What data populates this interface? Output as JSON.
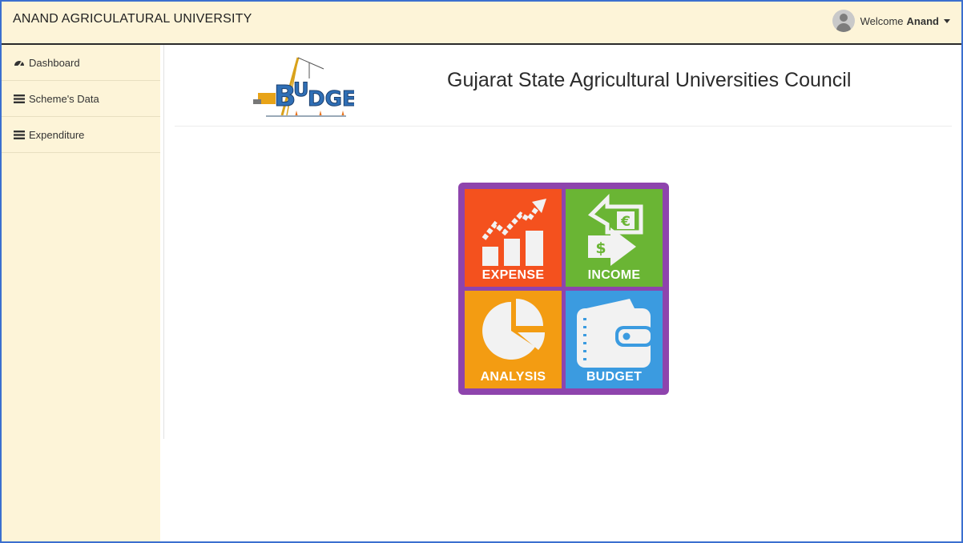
{
  "app": {
    "brand": "ANAND AGRICULATURAL UNIVERSITY",
    "welcome_text": "Welcome",
    "user_name": "Anand"
  },
  "sidebar": {
    "items": [
      {
        "label": "Dashboard",
        "icon": "dashboard-icon"
      },
      {
        "label": "Scheme's Data",
        "icon": "list-icon"
      },
      {
        "label": "Expenditure",
        "icon": "list-icon"
      }
    ]
  },
  "main": {
    "title": "Gujarat State Agricultural Universities Council",
    "logo_text": "BUDGET"
  },
  "tiles": [
    {
      "label": "EXPENSE",
      "color": "#f4511e",
      "icon": "growth-chart-icon"
    },
    {
      "label": "INCOME",
      "color": "#6ab534",
      "icon": "exchange-arrows-icon"
    },
    {
      "label": "ANALYSIS",
      "color": "#f39c12",
      "icon": "pie-chart-icon"
    },
    {
      "label": "BUDGET",
      "color": "#3b9be0",
      "icon": "wallet-icon"
    }
  ],
  "colors": {
    "navbar_bg": "#fdf4d8",
    "tile_border": "#8e44ad"
  }
}
